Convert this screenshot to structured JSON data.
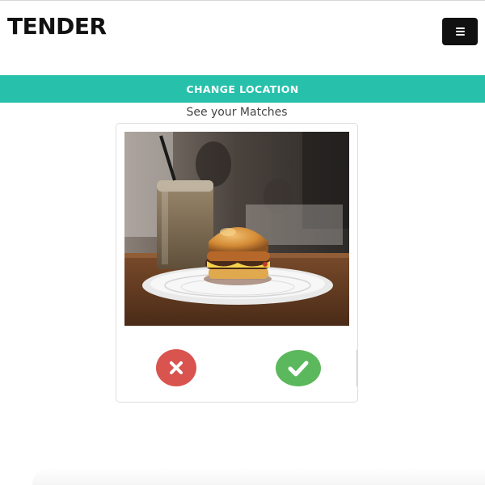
{
  "navbar": {
    "brand": "TENDER",
    "menu_icon": "hamburger-icon"
  },
  "location_bar": {
    "label": "CHANGE LOCATION",
    "color": "#26c0ab"
  },
  "subtitle": "See your Matches",
  "card": {
    "photo_subject": "burger-and-iced-drink-photo",
    "reject_icon": "close-icon",
    "accept_icon": "check-icon",
    "reject_color": "#d9534f",
    "accept_color": "#5cb85c"
  }
}
